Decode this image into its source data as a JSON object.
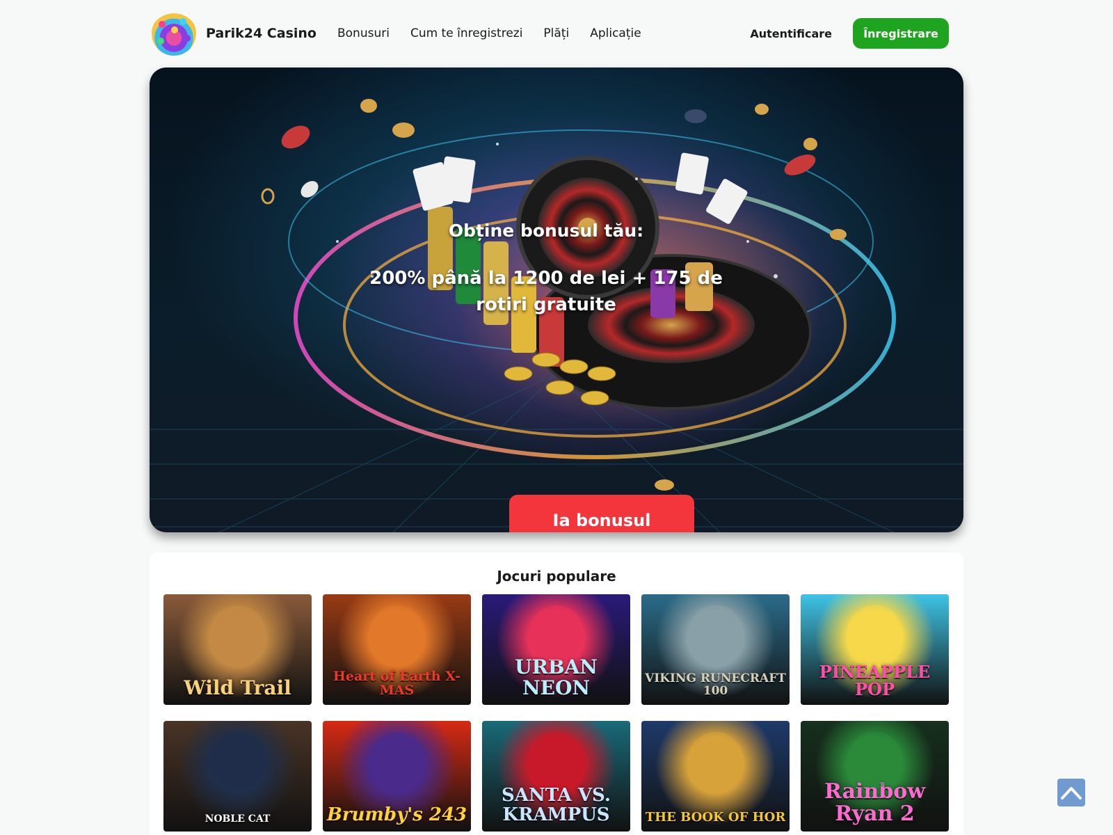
{
  "header": {
    "brand": "Parik24 Casino",
    "nav": [
      "Bonusuri",
      "Cum te înregistrezi",
      "Plăți",
      "Aplicație"
    ],
    "login": "Autentificare",
    "register": "Înregistrare"
  },
  "hero": {
    "title": "Obține bonusul tău:",
    "offer": "200% până la 1200 de lei + 175 de rotiri gratuite",
    "cta": "Ia bonusul"
  },
  "games": {
    "title": "Jocuri populare",
    "items": [
      {
        "name": "Wild Trail",
        "bg": "#8a5a3a",
        "accent": "#c48a45",
        "text": "#f7d27a"
      },
      {
        "name": "Heart of Earth X-MAS",
        "bg": "#9a3a14",
        "accent": "#e2782a",
        "text": "#e83a2a"
      },
      {
        "name": "URBAN NEON",
        "bg": "#2a1a7a",
        "accent": "#e8325a",
        "text": "#b9f0ff"
      },
      {
        "name": "VIKING RUNECRAFT 100",
        "bg": "#2a6c8a",
        "accent": "#8aa0a8",
        "text": "#d7d0b8"
      },
      {
        "name": "PINEAPPLE POP",
        "bg": "#3fc4e6",
        "accent": "#f5d84a",
        "text": "#ff4fa8"
      },
      {
        "name": "NOBLE CAT",
        "bg": "#4a3426",
        "accent": "#1f2e4a",
        "text": "#ffffff"
      },
      {
        "name": "Brumby's 243",
        "bg": "#d62a14",
        "accent": "#4a2a8a",
        "text": "#ffd23a"
      },
      {
        "name": "SANTA VS. KRAMPUS",
        "bg": "#1a6a7a",
        "accent": "#c81a2a",
        "text": "#c9e6ff"
      },
      {
        "name": "THE BOOK OF HOR",
        "bg": "#1e3a6a",
        "accent": "#d8a23a",
        "text": "#f5c63a"
      },
      {
        "name": "Rainbow Ryan 2",
        "bg": "#16301e",
        "accent": "#2a8a3a",
        "text": "#ff6ad1"
      }
    ]
  },
  "colors": {
    "register_green": "#1ea41e",
    "cta_red": "#f2363b",
    "scroll_top_blue": "#6f9bd1"
  },
  "icons": {
    "scroll_top": "chevron-up-icon",
    "logo": "casino-chips-logo-icon"
  }
}
